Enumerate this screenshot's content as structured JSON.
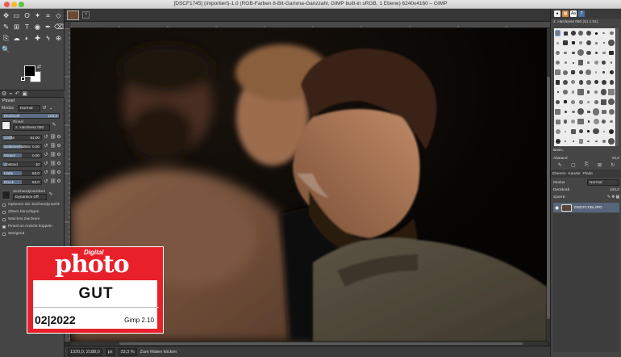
{
  "window": {
    "title": "[DSCF1745] (importiert)-1.0 (RGB-Farben 8-Bit-Gamma-Ganzzahl, GIMP built-in sRGB, 1 Ebene) 6240x4160 – GIMP"
  },
  "toolbox": {
    "tools": [
      "move-icon",
      "rect-select-icon",
      "lasso-icon",
      "fuzzy-select-icon",
      "crop-icon",
      "unified-transform-icon",
      "warp-icon",
      "align-icon",
      "text-icon",
      "bucket-fill-icon",
      "paintbrush-icon",
      "eraser-icon",
      "clone-icon",
      "smudge-icon",
      "dodge-icon",
      "color-picker-icon",
      "paths-icon",
      "zoom-icon",
      "magnify-icon"
    ],
    "tool_glyphs": [
      "✥",
      "▭",
      "ʘ",
      "✦",
      "⌗",
      "◇",
      "✎",
      "⊞",
      "T",
      "◉",
      "✒",
      "⌫",
      "⎘",
      "☁",
      "◐",
      "✚",
      "ϟ",
      "⊕",
      "🔍"
    ]
  },
  "tool_options": {
    "title": "Pinsel",
    "mode_label": "Modus",
    "mode_value": "Normal",
    "opacity_label": "Deckkraft",
    "opacity_value": "100,0",
    "brush_label": "Pinsel",
    "brush_value": "2. Hardness 050",
    "sliders": [
      {
        "label": "Größe",
        "value": "51,00",
        "fill": 0.25
      },
      {
        "label": "Seitenverhältnis",
        "value": "0,00",
        "fill": 0.5
      },
      {
        "label": "Winkel",
        "value": "0,00",
        "fill": 0.5
      },
      {
        "label": "Abstand",
        "value": "10",
        "fill": 0.1
      },
      {
        "label": "Härte",
        "value": "50,0",
        "fill": 0.5
      },
      {
        "label": "Druck",
        "value": "50,0",
        "fill": 0.5
      }
    ],
    "dynamics_label": "Zeichendynamiken",
    "dynamics_value": "Dynamics Off",
    "checks": [
      {
        "label": "Optionen der Zeichendynamik",
        "on": false
      },
      {
        "label": "Zittern hinzufügen",
        "on": false
      },
      {
        "label": "Weiches Zeichnen",
        "on": false
      },
      {
        "label": "Pinsel an Ansicht koppeln",
        "on": true
      },
      {
        "label": "Stetigend",
        "on": false
      }
    ]
  },
  "statusbar": {
    "coords": "1320,0, 2188,0",
    "unit": "px",
    "zoom": "33,3 %",
    "message": "Zum Malen klicken"
  },
  "brushes": {
    "name": "2. Hardness 050 (51 x 51)",
    "filter_label": "Basic,",
    "spacing_label": "Abstand",
    "spacing_value": "10,0"
  },
  "layers": {
    "tab_layers": "Ebenen",
    "tab_channels": "Kanäle",
    "tab_paths": "Pfade",
    "mode_label": "Modus",
    "mode_value": "Normal",
    "opacity_label": "Deckkraft",
    "opacity_value": "100,0",
    "lock_label": "Sperre:",
    "layer_name": "DSCF1745.JPG"
  },
  "badge": {
    "digital": "Digital",
    "brand": "photo",
    "rating": "GUT",
    "date": "02|2022",
    "product": "Gimp 2.10",
    "color": "#e8202a"
  }
}
